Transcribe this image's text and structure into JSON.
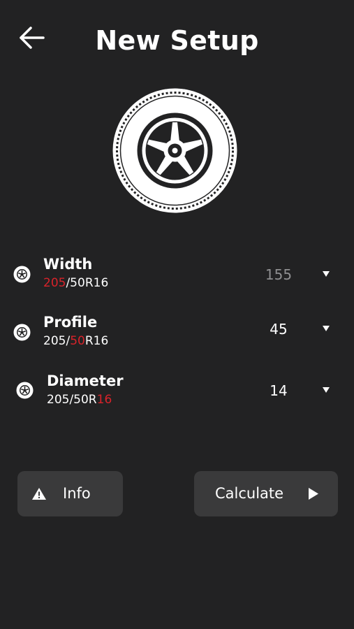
{
  "header": {
    "title": "New Setup",
    "back_icon": "arrow-left-icon"
  },
  "hero": {
    "icon": "tire-wheel-icon"
  },
  "fields": [
    {
      "label": "Width",
      "size_parts": [
        "205",
        "/50R16"
      ],
      "highlight": "width",
      "value": "155",
      "icon": "tire-icon"
    },
    {
      "label": "Profile",
      "size_parts": [
        "205/",
        "50",
        "R16"
      ],
      "highlight": "profile",
      "value": "45",
      "icon": "tire-icon"
    },
    {
      "label": "Diameter",
      "size_parts": [
        "205/50R",
        "16"
      ],
      "highlight": "diameter",
      "value": "14",
      "icon": "tire-icon"
    }
  ],
  "actions": {
    "info_label": "Info",
    "info_icon": "warning-icon",
    "calculate_label": "Calculate",
    "calculate_icon": "play-icon"
  },
  "colors": {
    "background": "#222223",
    "button": "#3a3a3b",
    "highlight": "#d8232a",
    "muted_value": "#8f8f91"
  }
}
